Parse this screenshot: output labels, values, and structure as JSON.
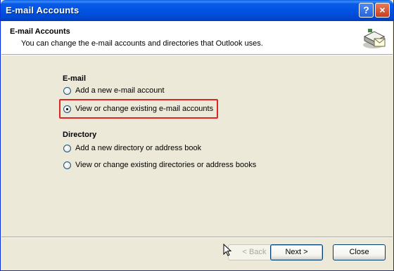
{
  "window": {
    "title": "E-mail Accounts"
  },
  "titlebar": {
    "help": "?",
    "close": "×"
  },
  "header": {
    "title": "E-mail Accounts",
    "subtitle": "You can change the e-mail accounts and directories that Outlook uses."
  },
  "email_group": {
    "label": "E-mail",
    "options": [
      {
        "label": "Add a new e-mail account",
        "checked": false
      },
      {
        "label": "View or change existing e-mail accounts",
        "checked": true
      }
    ]
  },
  "directory_group": {
    "label": "Directory",
    "options": [
      {
        "label": "Add a new directory or address book",
        "checked": false
      },
      {
        "label": "View or change existing directories or address books",
        "checked": false
      }
    ]
  },
  "buttons": {
    "back": "< Back",
    "next": "Next >",
    "close": "Close"
  },
  "colors": {
    "highlight": "#e02424",
    "titlebar": "#0054e3",
    "dialog_bg": "#ece9d8"
  }
}
